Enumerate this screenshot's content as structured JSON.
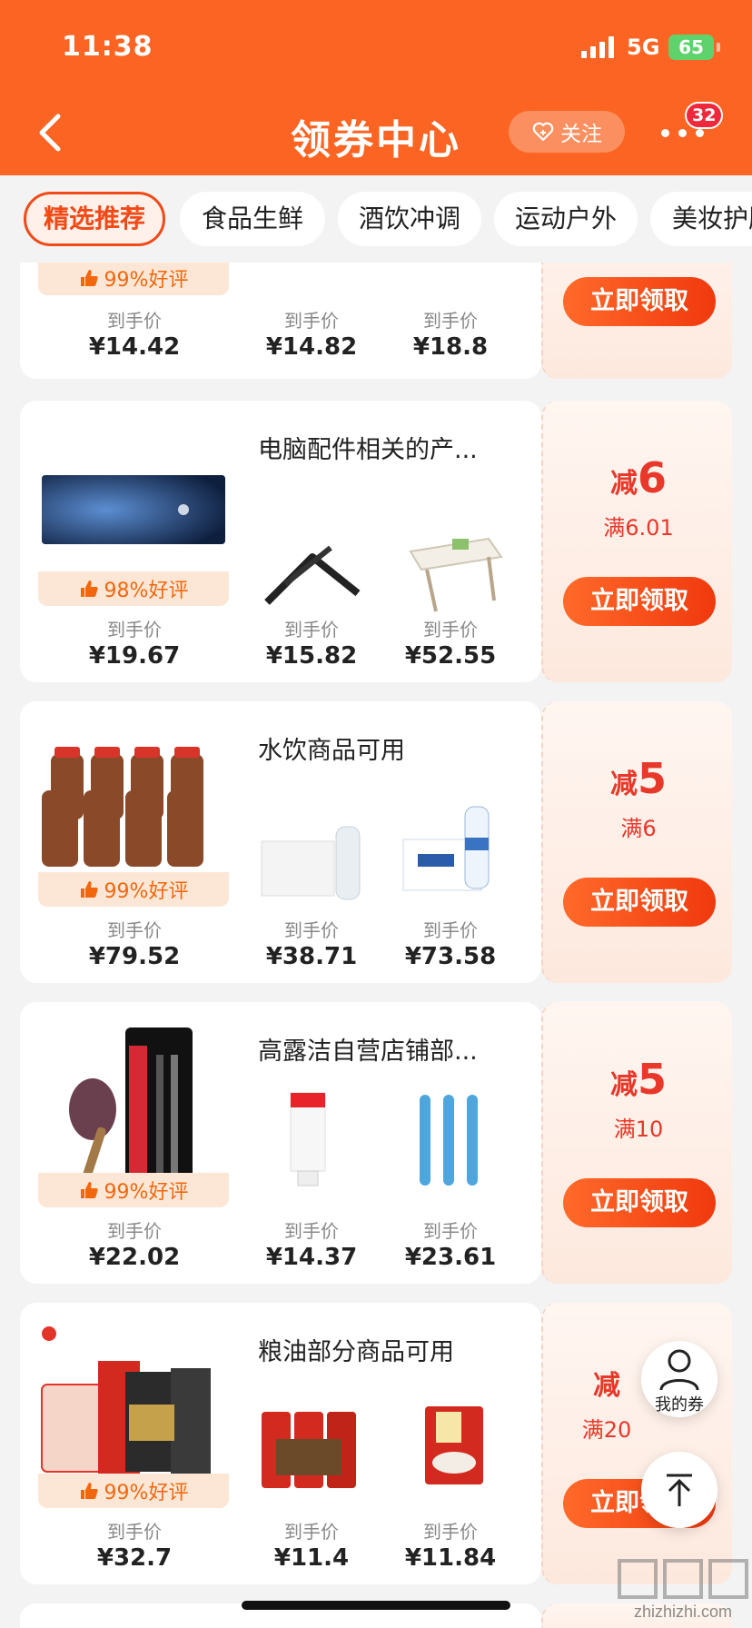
{
  "status_bar": {
    "time": "11:38",
    "network": "5G",
    "battery": "65"
  },
  "nav": {
    "title": "领券中心",
    "follow_label": "关注",
    "badge_count": "32",
    "back_icon": "chevron-left-icon",
    "more_icon": "more-dots-icon"
  },
  "tabs": [
    {
      "label": "精选推荐",
      "active": true
    },
    {
      "label": "食品生鲜",
      "active": false
    },
    {
      "label": "酒饮冲调",
      "active": false
    },
    {
      "label": "运动户外",
      "active": false
    },
    {
      "label": "美妆护肤",
      "active": false
    }
  ],
  "cards": [
    {
      "title": "",
      "rating": "99%好评",
      "products": [
        {
          "label": "到手价",
          "price": "¥14.42"
        },
        {
          "label": "到手价",
          "price": "¥14.82"
        },
        {
          "label": "到手价",
          "price": "¥18.8"
        }
      ],
      "coupon": {
        "reduce_label": "减",
        "amount": "",
        "threshold": "",
        "button": "立即领取"
      }
    },
    {
      "title": "电脑配件相关的产...",
      "rating": "98%好评",
      "products": [
        {
          "label": "到手价",
          "price": "¥19.67"
        },
        {
          "label": "到手价",
          "price": "¥15.82"
        },
        {
          "label": "到手价",
          "price": "¥52.55"
        }
      ],
      "coupon": {
        "reduce_label": "减",
        "amount": "6",
        "threshold": "满6.01",
        "button": "立即领取"
      }
    },
    {
      "title": "水饮商品可用",
      "rating": "99%好评",
      "products": [
        {
          "label": "到手价",
          "price": "¥79.52"
        },
        {
          "label": "到手价",
          "price": "¥38.71"
        },
        {
          "label": "到手价",
          "price": "¥73.58"
        }
      ],
      "coupon": {
        "reduce_label": "减",
        "amount": "5",
        "threshold": "满6",
        "button": "立即领取"
      }
    },
    {
      "title": "高露洁自营店铺部...",
      "rating": "99%好评",
      "products": [
        {
          "label": "到手价",
          "price": "¥22.02"
        },
        {
          "label": "到手价",
          "price": "¥14.37"
        },
        {
          "label": "到手价",
          "price": "¥23.61"
        }
      ],
      "coupon": {
        "reduce_label": "减",
        "amount": "5",
        "threshold": "满10",
        "button": "立即领取"
      }
    },
    {
      "title": "粮油部分商品可用",
      "rating": "99%好评",
      "products": [
        {
          "label": "到手价",
          "price": "¥32.7"
        },
        {
          "label": "到手价",
          "price": "¥11.4"
        },
        {
          "label": "到手价",
          "price": "¥11.84"
        }
      ],
      "coupon": {
        "reduce_label": "减",
        "amount": "",
        "threshold": "满20",
        "button": "立即领取"
      }
    }
  ],
  "floating": {
    "my_coupon_label": "我的券",
    "back_to_top_icon": "arrow-up-icon"
  },
  "watermark": {
    "brand": "值值值",
    "domain": "zhizhizhi.com"
  },
  "colors": {
    "accent": "#fb6422",
    "price_red": "#e8382a",
    "rating_orange": "#f2670e"
  }
}
